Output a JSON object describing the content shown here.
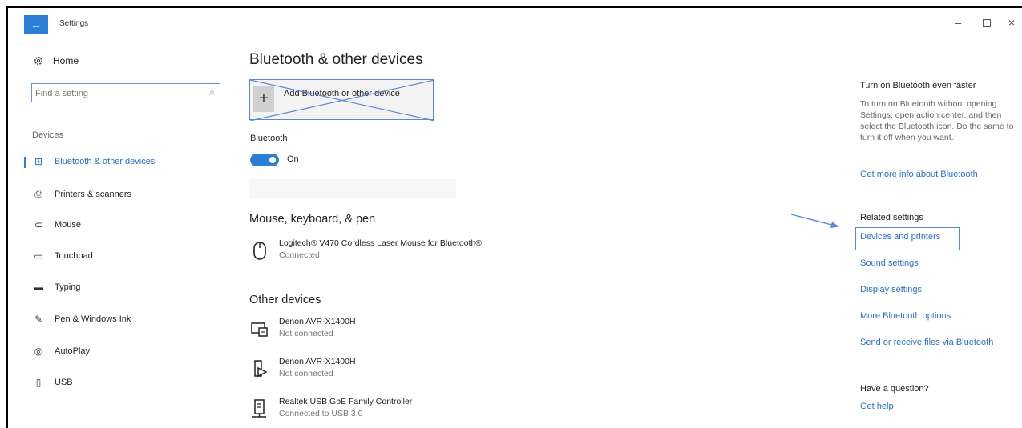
{
  "window": {
    "title": "Settings",
    "back_glyph": "←",
    "minimize_glyph": "–",
    "close_glyph": "×"
  },
  "sidebar": {
    "home_label": "Home",
    "search_placeholder": "Find a setting",
    "section_label": "Devices",
    "items": [
      {
        "label": "Bluetooth & other devices",
        "icon": "bluetooth-devices-icon",
        "glyph": "⊞",
        "active": true
      },
      {
        "label": "Printers & scanners",
        "icon": "printer-icon",
        "glyph": "⎙",
        "active": false
      },
      {
        "label": "Mouse",
        "icon": "mouse-icon",
        "glyph": "⊂",
        "active": false
      },
      {
        "label": "Touchpad",
        "icon": "touchpad-icon",
        "glyph": "▭",
        "active": false
      },
      {
        "label": "Typing",
        "icon": "keyboard-icon",
        "glyph": "▬",
        "active": false
      },
      {
        "label": "Pen & Windows Ink",
        "icon": "pen-icon",
        "glyph": "✎",
        "active": false
      },
      {
        "label": "AutoPlay",
        "icon": "autoplay-icon",
        "glyph": "◎",
        "active": false
      },
      {
        "label": "USB",
        "icon": "usb-icon",
        "glyph": "▯",
        "active": false
      }
    ]
  },
  "main": {
    "title": "Bluetooth & other devices",
    "add_device_label": "Add Bluetooth or other device",
    "add_device_glyph": "+",
    "bluetooth_label": "Bluetooth",
    "bluetooth_state": "On",
    "mouse_group_title": "Mouse, keyboard, & pen",
    "mouse_devices": [
      {
        "name": "Logitech® V470 Cordless Laser Mouse for Bluetooth®",
        "status": "Connected",
        "icon": "mouse-device-icon"
      }
    ],
    "other_group_title": "Other devices",
    "other_devices": [
      {
        "name": "Denon AVR-X1400H",
        "status": "Not connected",
        "icon": "media-device-icon"
      },
      {
        "name": "Denon AVR-X1400H",
        "status": "Not connected",
        "icon": "media-player-icon"
      },
      {
        "name": "Realtek USB GbE Family Controller",
        "status": "Connected to USB 3.0",
        "icon": "network-adapter-icon"
      }
    ]
  },
  "right_panel": {
    "faster_heading": "Turn on Bluetooth even faster",
    "faster_text": "To turn on Bluetooth without opening Settings, open action center, and then select the Bluetooth icon. Do the same to turn it off when you want.",
    "more_info_link": "Get more info about Bluetooth",
    "related_heading": "Related settings",
    "related_links": [
      "Devices and printers",
      "Sound settings",
      "Display settings",
      "More Bluetooth options",
      "Send or receive files via Bluetooth"
    ],
    "question_heading": "Have a question?",
    "help_link": "Get help"
  },
  "colors": {
    "accent": "#2d7fd6",
    "link": "#2d6fbf",
    "annotation": "#5a86d8"
  }
}
